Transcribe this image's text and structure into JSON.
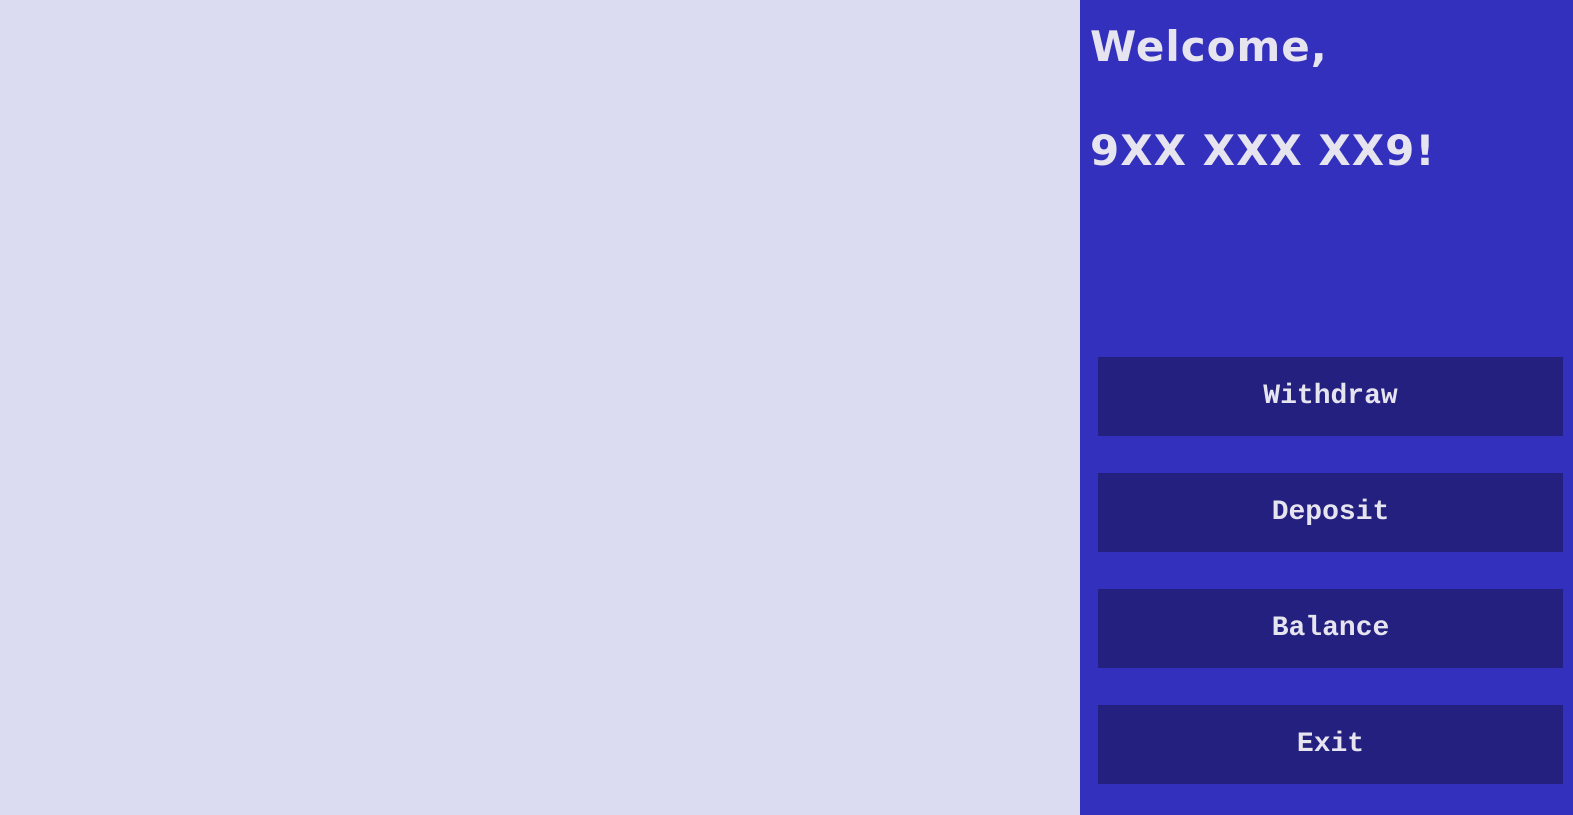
{
  "welcome": {
    "greeting": "Welcome,",
    "user_id": "9XX XXX XX9!"
  },
  "menu": {
    "withdraw_label": "Withdraw",
    "deposit_label": "Deposit",
    "balance_label": "Balance",
    "exit_label": "Exit"
  },
  "colors": {
    "background": "#dbdbf2",
    "panel": "#3330bd",
    "button": "#23207f",
    "text": "#e6e4ef"
  }
}
